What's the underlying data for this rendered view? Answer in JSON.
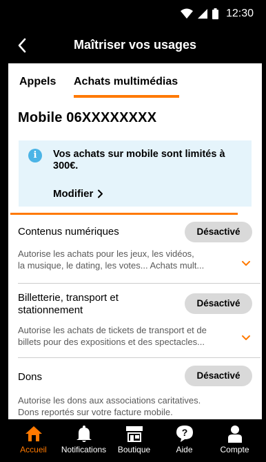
{
  "status_bar": {
    "time": "12:30"
  },
  "app_bar": {
    "title": "Maîtriser vos usages"
  },
  "tabs": [
    {
      "label": "Appels",
      "active": false
    },
    {
      "label": "Achats multimédias",
      "active": true
    }
  ],
  "mobile_title": "Mobile 06XXXXXXXX",
  "info_box": {
    "message": "Vos achats sur mobile sont limités à 300€.",
    "action_label": "Modifier"
  },
  "sections": [
    {
      "title": "Contenus numériques",
      "status": "Désactivé",
      "description_line1": "Autorise les achats pour les jeux, les vidéos,",
      "description_line2": "la musique, le dating, les votes... Achats mult..."
    },
    {
      "title_line1": "Billetterie, transport et",
      "title_line2": "stationnement",
      "status": "Désactivé",
      "description_line1": "Autorise les achats de tickets de transport et de",
      "description_line2": "billets pour des expositions et des spectacles..."
    },
    {
      "title": "Dons",
      "status": "Désactivé",
      "description_line1": "Autorise les dons aux associations caritatives.",
      "description_line2": "Dons reportés sur votre facture mobile."
    }
  ],
  "bottom_nav": [
    {
      "label": "Accueil",
      "icon": "home-icon",
      "active": true
    },
    {
      "label": "Notifications",
      "icon": "bell-icon",
      "active": false
    },
    {
      "label": "Boutique",
      "icon": "shop-icon",
      "active": false
    },
    {
      "label": "Aide",
      "icon": "help-icon",
      "active": false
    },
    {
      "label": "Compte",
      "icon": "account-icon",
      "active": false
    }
  ],
  "colors": {
    "accent": "#ff7900",
    "info_bg": "#e5f4fb",
    "info_icon": "#4bb4e6",
    "badge_bg": "#d9d9d9"
  }
}
